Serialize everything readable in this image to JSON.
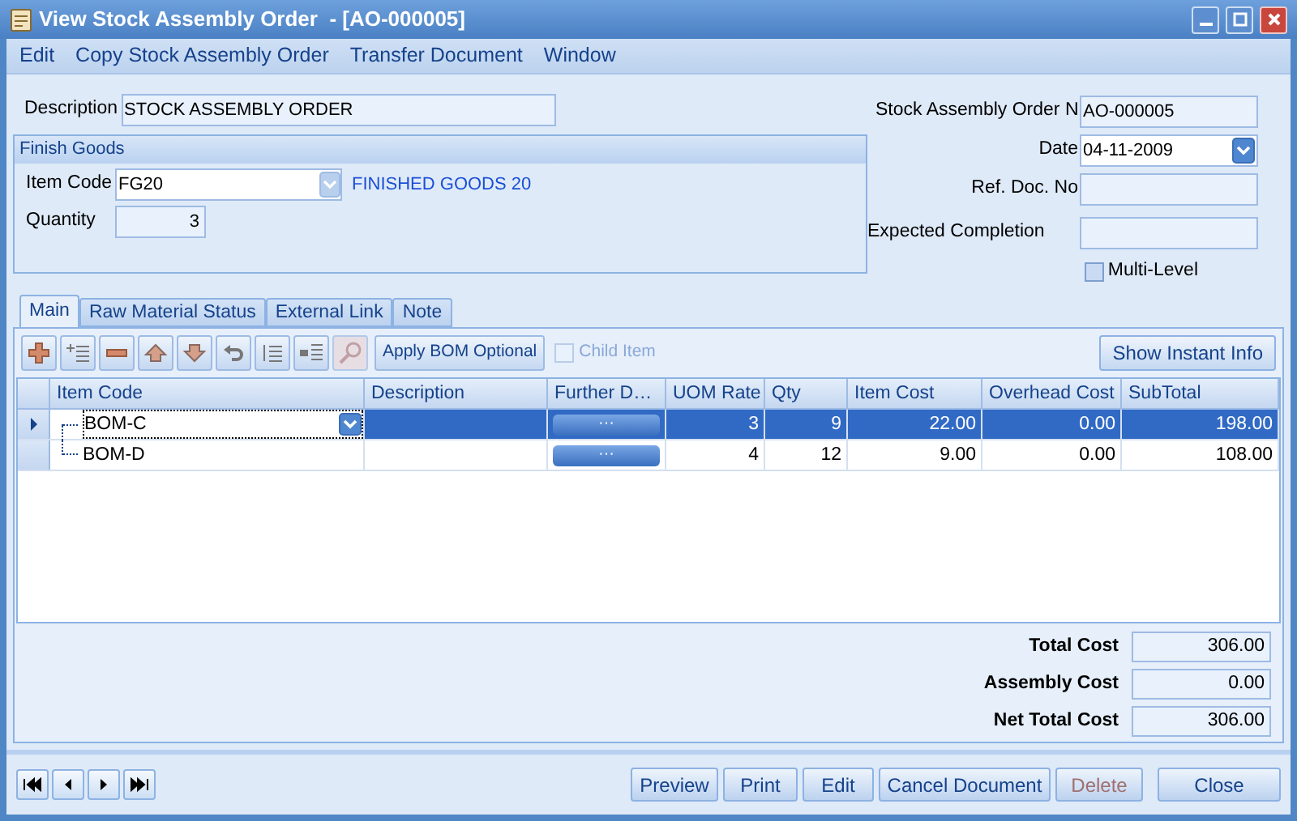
{
  "window": {
    "title": "View Stock Assembly Order  - [AO-000005]"
  },
  "menu": [
    "Edit",
    "Copy Stock Assembly Order",
    "Transfer Document",
    "Window"
  ],
  "description": {
    "label": "Description",
    "value": "STOCK ASSEMBLY ORDER"
  },
  "finish_goods": {
    "title": "Finish Goods",
    "item_code_label": "Item Code",
    "item_code": "FG20",
    "item_name": "FINISHED GOODS 20",
    "quantity_label": "Quantity",
    "quantity": "3"
  },
  "header_fields": [
    {
      "label": "Stock Assembly Order N",
      "value": "AO-000005",
      "kind": "text"
    },
    {
      "label": "Date",
      "value": "04-11-2009",
      "kind": "date"
    },
    {
      "label": "Ref. Doc. No",
      "kind": "text"
    },
    {
      "label": "Expected Completion",
      "kind": "text"
    }
  ],
  "multi_level": {
    "label": "Multi-Level",
    "checked": false
  },
  "tabs": [
    {
      "label": "Main",
      "selected": true
    },
    {
      "label": "Raw Material Status",
      "selected": false
    },
    {
      "label": "External Link",
      "selected": false
    },
    {
      "label": "Note",
      "selected": false
    }
  ],
  "toolbar": {
    "tools": [
      {
        "kind": "add",
        "disabled": false
      },
      {
        "kind": "insert",
        "disabled": false
      },
      {
        "kind": "remove",
        "disabled": false
      },
      {
        "kind": "up",
        "disabled": false
      },
      {
        "kind": "down",
        "disabled": false
      },
      {
        "kind": "undo",
        "disabled": false
      },
      {
        "kind": "indent",
        "disabled": false
      },
      {
        "kind": "outdent",
        "disabled": false
      },
      {
        "kind": "search",
        "disabled": true
      }
    ],
    "apply_button": "Apply BOM Optional",
    "child_item": {
      "label": "Child Item",
      "checked": false,
      "disabled": true
    },
    "info_button": "Show Instant Info"
  },
  "table": {
    "columns": [
      "Item Code",
      "Description",
      "Further D…",
      "UOM Rate",
      "Qty",
      "Item Cost",
      "Overhead Cost",
      "SubTotal"
    ],
    "rows": [
      {
        "selected": true,
        "item_code": "BOM-C",
        "further": "···",
        "uom_rate": "3",
        "qty": "9",
        "item_cost": "22.00",
        "overhead_cost": "0.00",
        "subtotal": "198.00"
      },
      {
        "selected": false,
        "item_code": "BOM-D",
        "further": "···",
        "uom_rate": "4",
        "qty": "12",
        "item_cost": "9.00",
        "overhead_cost": "0.00",
        "subtotal": "108.00"
      }
    ]
  },
  "totals": [
    {
      "label": "Total Cost",
      "value": "306.00"
    },
    {
      "label": "Assembly Cost",
      "value": "0.00"
    },
    {
      "label": "Net Total Cost",
      "value": "306.00"
    }
  ],
  "nav": [
    {
      "kind": "first"
    },
    {
      "kind": "prev"
    },
    {
      "kind": "next"
    },
    {
      "kind": "last"
    }
  ],
  "buttons": [
    {
      "label": "Preview",
      "disabled": false
    },
    {
      "label": "Print",
      "disabled": false
    },
    {
      "label": "Edit",
      "disabled": false
    },
    {
      "label": "Cancel Document",
      "disabled": false
    },
    {
      "label": "Delete",
      "disabled": true
    },
    {
      "label": "Close",
      "disabled": false
    }
  ]
}
